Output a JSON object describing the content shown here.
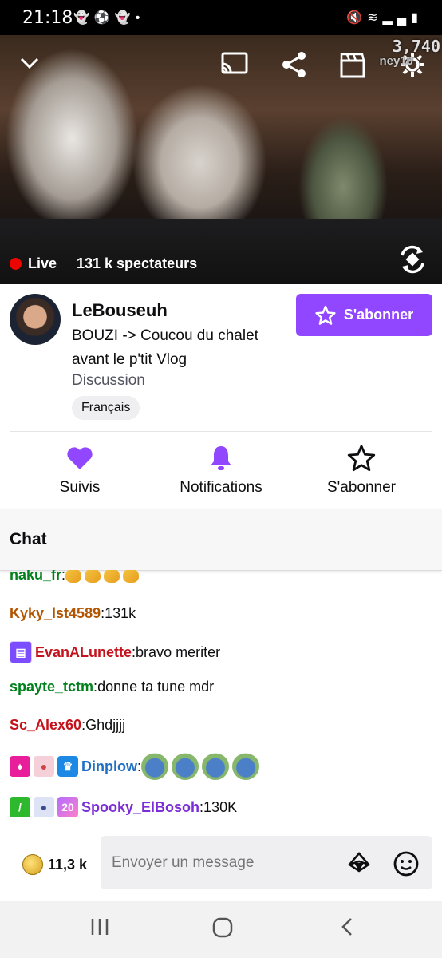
{
  "status_bar": {
    "time": "21:18",
    "left_icons": [
      "snapchat-icon",
      "soccer-ball-icon",
      "snapchat-icon",
      "dot-icon"
    ],
    "right_icons": [
      "mute-icon",
      "wifi-icon",
      "signal-icon",
      "battery-icon"
    ]
  },
  "video": {
    "overlay_count": "3,740",
    "watermark": "ney10",
    "live_label": "Live",
    "viewers": "131 k spectateurs"
  },
  "channel": {
    "name": "LeBouseuh",
    "title": "BOUZI -> Coucou du chalet avant le p'tit Vlog",
    "category": "Discussion",
    "language_tag": "Français",
    "subscribe_button": "S'abonner"
  },
  "actions": {
    "follow": "Suivis",
    "notifications": "Notifications",
    "subscribe": "S'abonner"
  },
  "chat": {
    "header": "Chat",
    "messages": [
      {
        "user": "naku_fr",
        "sep": ": ",
        "text": "",
        "color": "#00801a"
      },
      {
        "user": "Kyky_lst4589",
        "sep": ": ",
        "text": "131k",
        "color": "#b35400"
      },
      {
        "user": "EvanALunette",
        "sep": ": ",
        "text": "bravo meriter",
        "color": "#c4131d"
      },
      {
        "user": "spayte_tctm",
        "sep": ": ",
        "text": "donne ta tune mdr",
        "color": "#00801a"
      },
      {
        "user": "Sc_Alex60",
        "sep": ": ",
        "text": "Ghdjjjj",
        "color": "#c4131d"
      },
      {
        "user": "Dinplow",
        "sep": ":",
        "text": "",
        "color": "#1e6fc5"
      },
      {
        "user": "Spooky_ElBosoh",
        "sep": ": ",
        "text": "130K",
        "color": "#7b2ed6"
      }
    ],
    "badge_number": "20"
  },
  "composer": {
    "bits": "11,3 k",
    "placeholder": "Envoyer un message"
  },
  "colors": {
    "accent": "#9147ff",
    "live_red": "#eb0400"
  }
}
